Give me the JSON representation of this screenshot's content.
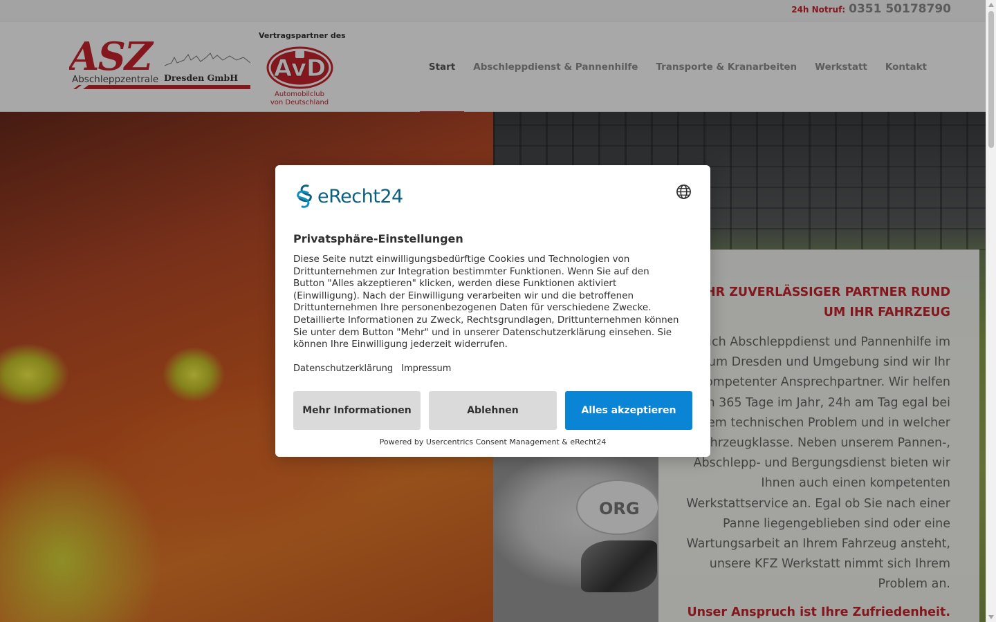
{
  "topbar": {
    "hotline_label": "24h Notruf:",
    "hotline_number": "0351 50178790"
  },
  "header": {
    "logo_asz_big": "ASZ",
    "logo_asz_sub": "Abschleppzentrale",
    "logo_asz_city": "Dresden GmbH",
    "avd_caption": "Vertragspartner des",
    "avd_logo_text": "AvD",
    "avd_sub_line1": "Automobilclub",
    "avd_sub_line2": "von Deutschland"
  },
  "nav": {
    "items": [
      {
        "label": "Start",
        "active": true
      },
      {
        "label": "Abschleppdienst & Pannenhilfe"
      },
      {
        "label": "Transporte & Kranarbeiten"
      },
      {
        "label": "Werkstatt"
      },
      {
        "label": "Kontakt"
      }
    ]
  },
  "hero": {
    "car_badge": "ORG",
    "title_line1": "IHR ZUVERLÄSSIGER PARTNER RUND",
    "title_line2": "UM IHR FAHRZEUG",
    "text": "Im Bereich Abschleppdienst und Pannenhilfe im Großraum Dresden und Umgebung sind wir Ihr kompetenter Ansprechpartner. Wir helfen Ihnen 365 Tage im Jahr, 24h am Tag egal bei welchem technischen Problem und in welcher Fahrzeugklasse. Neben unserem Pannen-, Abschlepp- und Bergungsdienst bieten wir Ihnen auch einen kompetenten Werkstattservice an. Egal ob Sie nach einer Panne liegengeblieben sind oder eine Wartungsarbeit an Ihrem Fahrzeug ansteht, unsere  KFZ Werkstatt nimmt sich Ihrem Problem an.",
    "claim": "Unser Anspruch ist Ihre Zufriedenheit."
  },
  "consent": {
    "logo_text": "eRecht24",
    "title": "Privatsphäre-Einstellungen",
    "text": "Diese Seite nutzt einwilligungsbedürftige Cookies und Technologien von Drittunternehmen zur Integration bestimmter Funktionen. Wenn Sie auf den Button \"Alles akzeptieren\" klicken, werden diese Funktionen aktiviert (Einwilligung). Nach der Einwilligung verarbeiten wir und die betroffenen Drittunternehmen Ihre personenbezogenen Daten für verschiedene Zwecke. Detaillierte Informationen zu Zweck, Rechtsgrundlagen, Drittunternehmen können Sie unter dem Button \"Mehr\" und in unserer Datenschutzerklärung einsehen. Sie können Ihre Einwilligung jederzeit widerrufen.",
    "link_privacy": "Datenschutzerklärung",
    "link_imprint": "Impressum",
    "btn_more": "Mehr Informationen",
    "btn_deny": "Ablehnen",
    "btn_accept": "Alles akzeptieren",
    "powered_by": "Powered by Usercentrics Consent Management & eRecht24"
  },
  "colors": {
    "brand_red": "#c8232c",
    "accept_blue": "#0a84d4",
    "erecht_teal": "#0b5f7f"
  }
}
